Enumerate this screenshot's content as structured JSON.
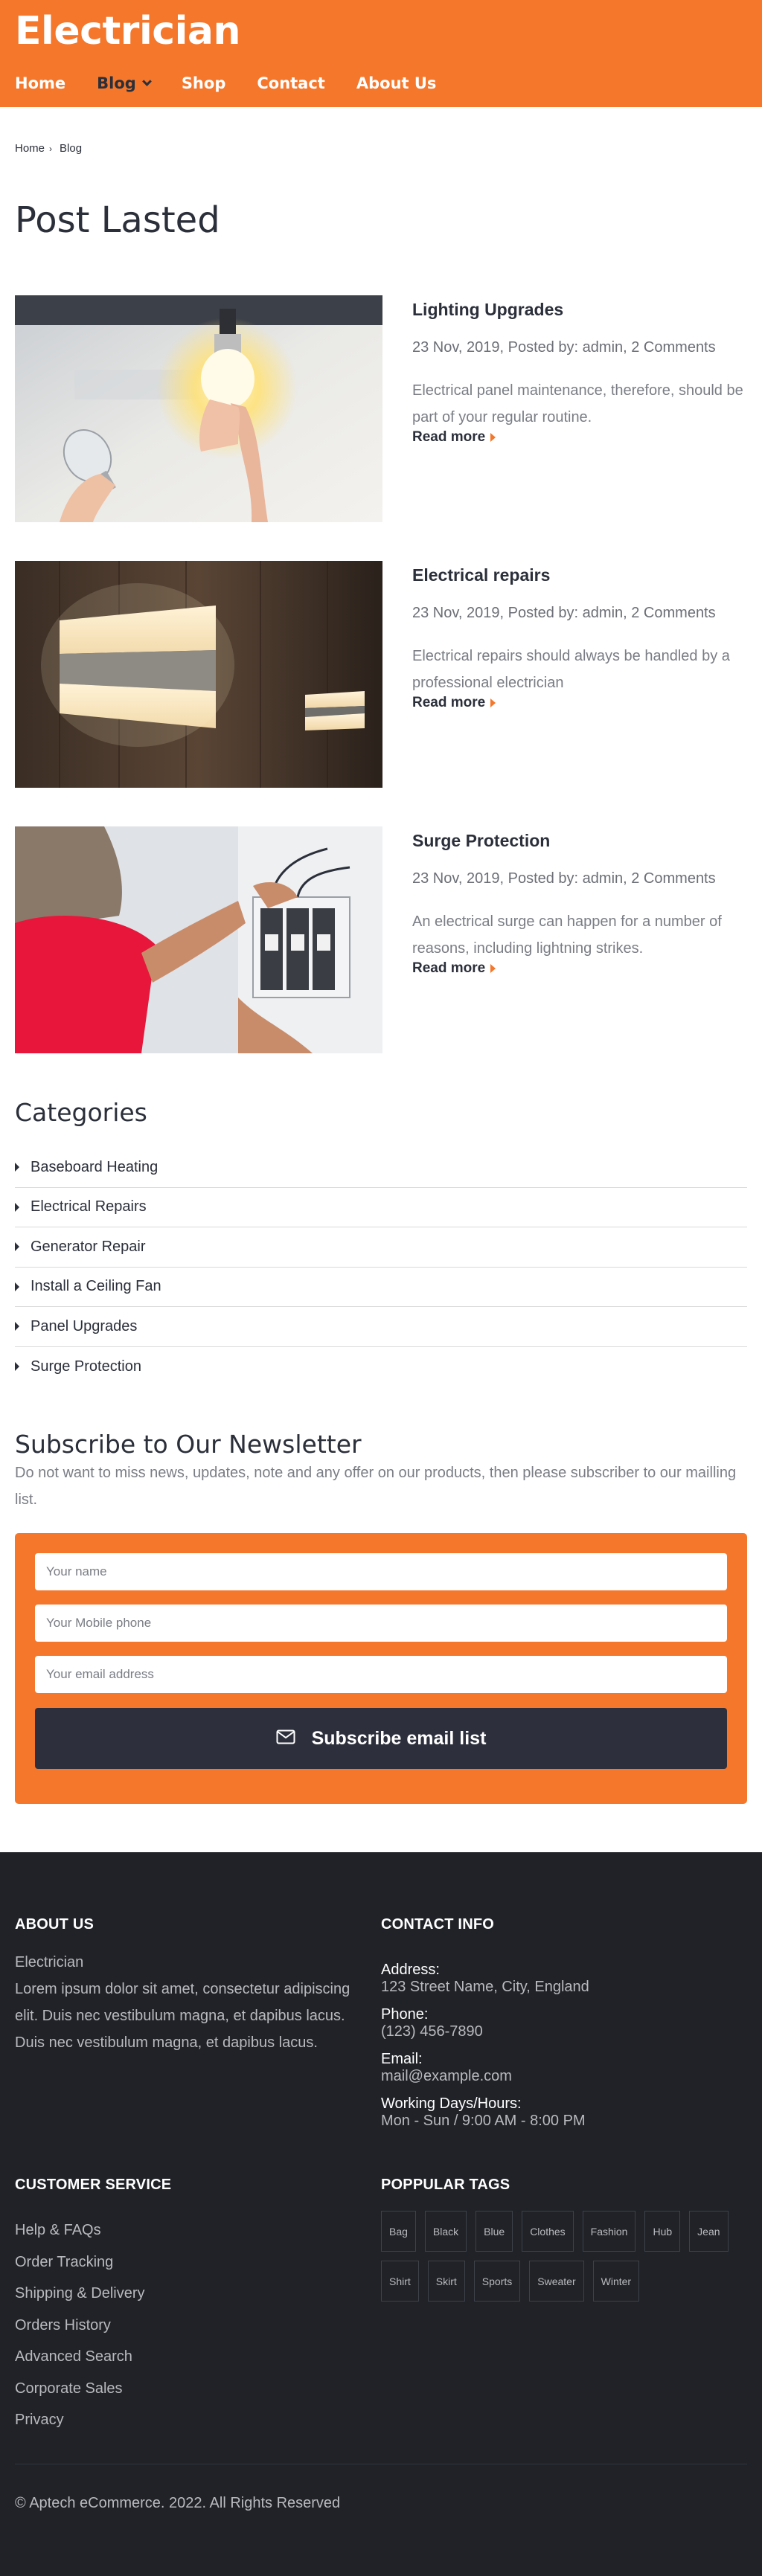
{
  "header": {
    "brand": "Electrician",
    "nav": [
      {
        "label": "Home"
      },
      {
        "label": "Blog"
      },
      {
        "label": "Shop"
      },
      {
        "label": "Contact"
      },
      {
        "label": "About Us"
      }
    ]
  },
  "breadcrumb": {
    "items": [
      "Home",
      "Blog"
    ],
    "separator": "›"
  },
  "page_title": "Post Lasted",
  "posts": [
    {
      "title": "Lighting Upgrades",
      "meta": "23 Nov, 2019, Posted by: admin, 2 Comments",
      "excerpt": "Electrical panel maintenance, therefore, should be part of your regular routine.",
      "read_more": "Read more",
      "image_icon": "light-bulb-photo"
    },
    {
      "title": "Electrical repairs",
      "meta": "23 Nov, 2019, Posted by: admin, 2 Comments",
      "excerpt": "Electrical repairs should always be handled by a professional electrician",
      "read_more": "Read more",
      "image_icon": "wall-lamp-photo"
    },
    {
      "title": "Surge Protection",
      "meta": "23 Nov, 2019, Posted by: admin, 2 Comments",
      "excerpt": "An electrical surge can happen for a number of reasons, including lightning strikes.",
      "read_more": "Read more",
      "image_icon": "electrician-breaker-photo"
    }
  ],
  "categories": {
    "title": "Categories",
    "items": [
      "Baseboard Heating",
      "Electrical Repairs",
      "Generator Repair",
      "Install a Ceiling Fan",
      "Panel Upgrades",
      "Surge Protection"
    ]
  },
  "newsletter": {
    "title": "Subscribe to Our Newsletter",
    "description": "Do not want to miss news, updates, note and any offer on our products, then please subscriber to our mailling list.",
    "name_placeholder": "Your name",
    "phone_placeholder": "Your Mobile phone",
    "email_placeholder": "Your email address",
    "button_label": "Subscribe email list",
    "button_icon": "envelope-icon"
  },
  "footer": {
    "about_heading": "ABOUT US",
    "about_text": "Electrician\nLorem ipsum dolor sit amet, consectetur adipiscing elit. Duis nec vestibulum magna, et dapibus lacus. Duis nec vestibulum magna, et dapibus lacus.",
    "contact_heading": "CONTACT INFO",
    "contact": [
      {
        "label": "Address:",
        "value": "123 Street Name, City, England"
      },
      {
        "label": "Phone:",
        "value": "(123) 456-7890"
      },
      {
        "label": "Email:",
        "value": "mail@example.com"
      },
      {
        "label": "Working Days/Hours:",
        "value": "Mon - Sun / 9:00 AM - 8:00 PM"
      }
    ],
    "service_heading": "CUSTOMER SERVICE",
    "service_links": [
      "Help & FAQs",
      "Order Tracking",
      "Shipping & Delivery",
      "Orders History",
      "Advanced Search",
      "Corporate Sales",
      "Privacy"
    ],
    "tags_heading": "POPPULAR TAGS",
    "tags": [
      "Bag",
      "Black",
      "Blue",
      "Clothes",
      "Fashion",
      "Hub",
      "Jean",
      "Shirt",
      "Skirt",
      "Sports",
      "Sweater",
      "Winter"
    ],
    "copyright": "© Aptech eCommerce. 2022. All Rights Reserved"
  },
  "colors": {
    "accent": "#f4772b",
    "dark": "#2b2f3a",
    "footer_bg": "#202227",
    "button_bg": "#2d303c"
  }
}
